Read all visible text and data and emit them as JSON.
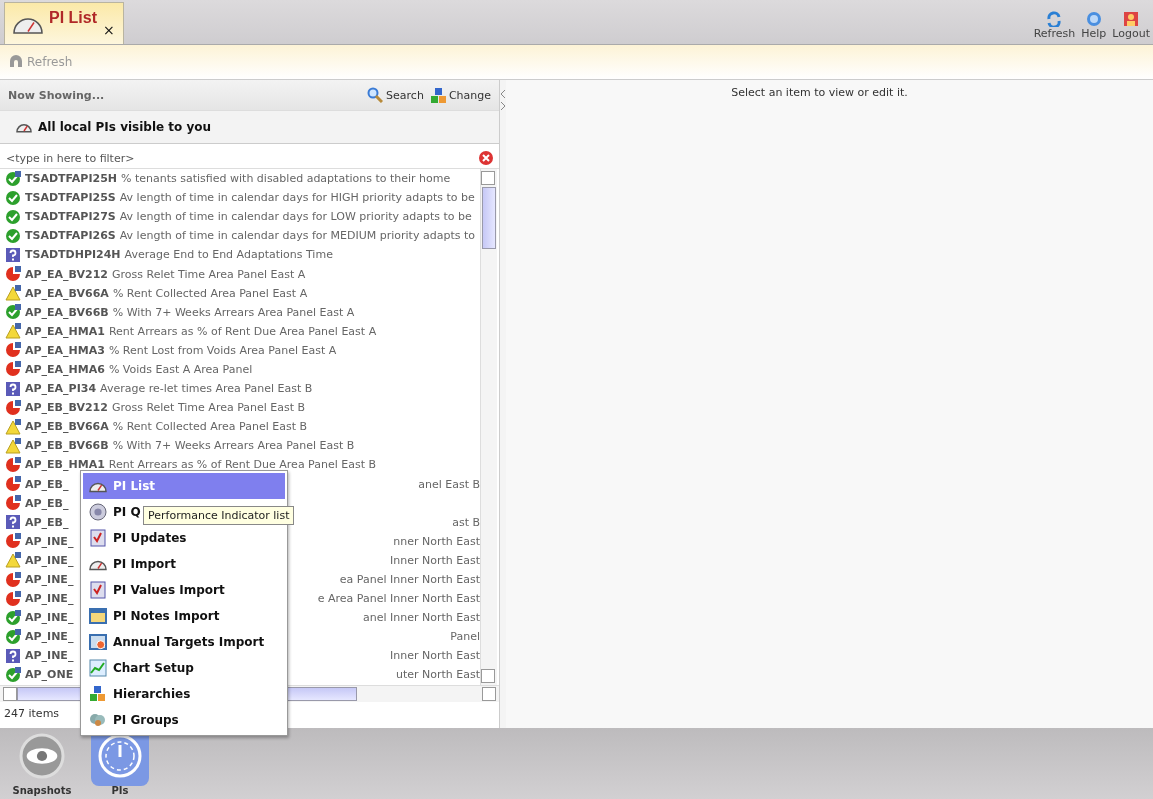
{
  "tabs": [
    {
      "label": "PI List",
      "selected": true,
      "close": "×"
    }
  ],
  "header_actions": [
    {
      "kind": "refresh",
      "label": "Refresh"
    },
    {
      "kind": "help",
      "label": "Help"
    },
    {
      "kind": "logout",
      "label": "Logout"
    }
  ],
  "toolbar": {
    "refresh": "Refresh"
  },
  "left_panel": {
    "title": "Now Showing...",
    "search": "Search",
    "change": "Change",
    "scope": "All local PIs visible to you",
    "filter": {
      "placeholder": "<type in here to filter>"
    },
    "rows": [
      {
        "kind": "good-note",
        "code": "TSADTFAPI25H",
        "text": "% tenants satisfied with disabled adaptations to their home"
      },
      {
        "kind": "good",
        "code": "TSADTFAPI25S",
        "text": "Av length of time in calendar days for HIGH priority adapts to be"
      },
      {
        "kind": "good",
        "code": "TSADTFAPI27S",
        "text": "Av length of time in calendar days for LOW priority adapts to be"
      },
      {
        "kind": "good",
        "code": "TSADTFAPI26S",
        "text": "Av length of time in calendar days for MEDIUM priority adapts to"
      },
      {
        "kind": "unknown",
        "code": "TSADTDHPI24H",
        "text": "Average End to End Adaptations Time"
      },
      {
        "kind": "bad",
        "code": "AP_EA_BV212",
        "text": "Gross Relet Time Area Panel East A"
      },
      {
        "kind": "warn",
        "code": "AP_EA_BV66A",
        "text": "% Rent Collected Area Panel East A"
      },
      {
        "kind": "good-note",
        "code": "AP_EA_BV66B",
        "text": "% With 7+ Weeks Arrears Area Panel East A"
      },
      {
        "kind": "warn",
        "code": "AP_EA_HMA1",
        "text": "Rent Arrears as % of Rent Due Area Panel East A"
      },
      {
        "kind": "bad",
        "code": "AP_EA_HMA3",
        "text": "% Rent Lost from Voids Area Panel East A"
      },
      {
        "kind": "bad",
        "code": "AP_EA_HMA6",
        "text": "% Voids East A Area Panel"
      },
      {
        "kind": "unknown",
        "code": "AP_EA_PI34",
        "text": "Average re-let times Area Panel East B"
      },
      {
        "kind": "bad",
        "code": "AP_EB_BV212",
        "text": "Gross Relet Time Area Panel East B"
      },
      {
        "kind": "warn",
        "code": "AP_EB_BV66A",
        "text": "% Rent Collected Area Panel East B"
      },
      {
        "kind": "warn",
        "code": "AP_EB_BV66B",
        "text": "% With 7+ Weeks Arrears Area Panel East B"
      },
      {
        "kind": "bad",
        "code": "AP_EB_HMA1",
        "text": "Rent Arrears as % of Rent Due Area Panel East B"
      },
      {
        "kind": "bad",
        "code": "AP_EB_",
        "tail": "anel East B"
      },
      {
        "kind": "bad",
        "code": "AP_EB_"
      },
      {
        "kind": "unknown",
        "code": "AP_EB_",
        "tail": "ast B"
      },
      {
        "kind": "bad",
        "code": "AP_INE_",
        "tail": "nner North East"
      },
      {
        "kind": "warn",
        "code": "AP_INE_",
        "tail": "Inner North East"
      },
      {
        "kind": "bad",
        "code": "AP_INE_",
        "tail": "ea Panel Inner North East"
      },
      {
        "kind": "bad",
        "code": "AP_INE_",
        "tail": "e Area Panel Inner North East"
      },
      {
        "kind": "good-note",
        "code": "AP_INE_",
        "tail": "anel Inner North East"
      },
      {
        "kind": "good-note",
        "code": "AP_INE_",
        "tail": "Panel"
      },
      {
        "kind": "unknown",
        "code": "AP_INE_",
        "tail": "Inner North East"
      },
      {
        "kind": "good-note",
        "code": "AP_ONE",
        "tail": "uter North East"
      }
    ],
    "count": "247 items"
  },
  "detail": {
    "message": "Select an item to view or edit it."
  },
  "menu": [
    {
      "kind": "gauge",
      "label": "PI List",
      "selected": true
    },
    {
      "kind": "dial",
      "label": "PI Q",
      "selected": false
    },
    {
      "kind": "check",
      "label": "PI Updates",
      "selected": false
    },
    {
      "kind": "gauge",
      "label": "PI Import",
      "selected": false
    },
    {
      "kind": "check",
      "label": "PI Values Import",
      "selected": false
    },
    {
      "kind": "notes",
      "label": "PI Notes Import",
      "selected": false
    },
    {
      "kind": "target",
      "label": "Annual Targets Import",
      "selected": false
    },
    {
      "kind": "chart",
      "label": "Chart Setup",
      "selected": false
    },
    {
      "kind": "cubes",
      "label": "Hierarchies",
      "selected": false
    },
    {
      "kind": "group",
      "label": "PI Groups",
      "selected": false
    }
  ],
  "tooltip": "Performance Indicator list",
  "dock": [
    {
      "kind": "eye",
      "label": "Snapshots",
      "selected": false
    },
    {
      "kind": "gauge",
      "label": "PIs",
      "selected": true
    }
  ]
}
